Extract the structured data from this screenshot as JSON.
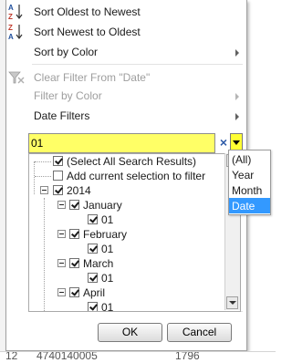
{
  "menu": {
    "sort_oldest": "Sort Oldest to Newest",
    "sort_newest": "Sort Newest to Oldest",
    "sort_by_color": "Sort by Color",
    "clear_filter": "Clear Filter From \"Date\"",
    "filter_by_color": "Filter by Color",
    "date_filters": "Date Filters"
  },
  "icons": {
    "sort_asc": {
      "top": "A",
      "bottom": "Z"
    },
    "sort_desc": {
      "top": "Z",
      "bottom": "A"
    }
  },
  "search": {
    "value": "01",
    "clear_glyph": "×",
    "highlight_color": "#ffff66"
  },
  "tree": {
    "select_all": "(Select All Search Results)",
    "add_current": "Add current selection to filter",
    "year": "2014",
    "months": [
      {
        "label": "January",
        "day": "01"
      },
      {
        "label": "February",
        "day": "01"
      },
      {
        "label": "March",
        "day": "01"
      },
      {
        "label": "April",
        "day": "01"
      }
    ]
  },
  "dropdown": {
    "options": [
      "(All)",
      "Year",
      "Month",
      "Date"
    ],
    "selected": "Date",
    "selected_color": "#3399ff"
  },
  "buttons": {
    "ok": "OK",
    "cancel": "Cancel"
  },
  "bottom_row": {
    "row_number": "12",
    "value_a": "4740140005",
    "value_b": "1796"
  }
}
